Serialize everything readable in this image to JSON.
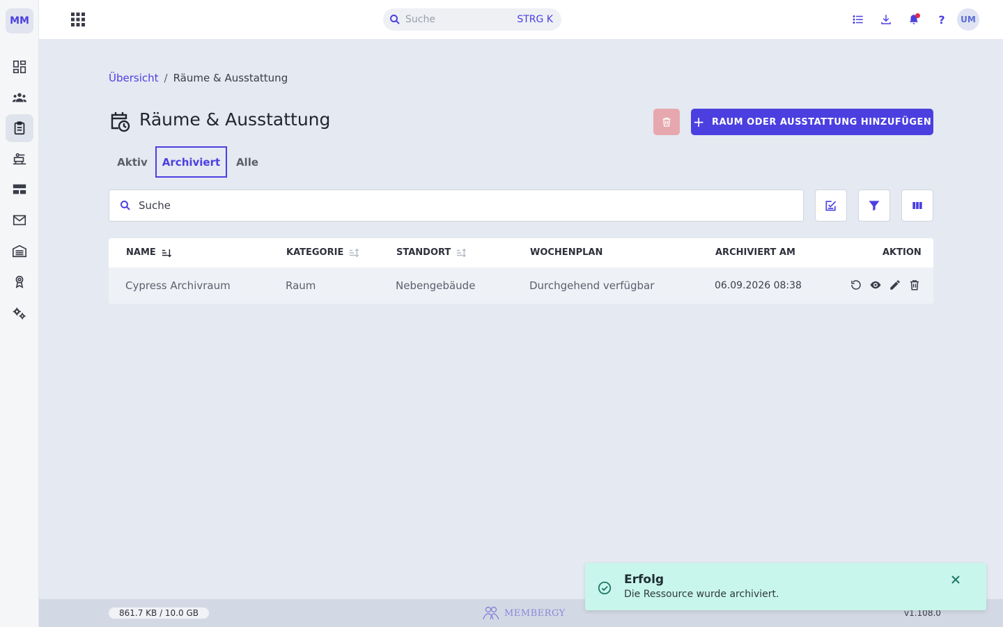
{
  "app": {
    "logo_text": "MM",
    "user_initials": "UM",
    "accent_color": "#4b3fe0"
  },
  "sidebar": {
    "items": [
      {
        "icon": "dashboard-icon"
      },
      {
        "icon": "members-icon"
      },
      {
        "icon": "clipboard-icon",
        "active": true
      },
      {
        "icon": "courses-icon"
      },
      {
        "icon": "layout-icon"
      },
      {
        "icon": "mail-icon"
      },
      {
        "icon": "warehouse-icon"
      },
      {
        "icon": "award-icon"
      },
      {
        "icon": "settings-icon"
      }
    ]
  },
  "topbar": {
    "search_placeholder": "Suche",
    "search_shortcut": "STRG K",
    "help_label": "?",
    "notification_dot_color": "#e5294a"
  },
  "breadcrumb": {
    "parent": "Übersicht",
    "separator": "/",
    "current": "Räume & Ausstattung"
  },
  "page": {
    "title": "Räume & Ausstattung",
    "add_button_label": "RAUM ODER AUSSTATTUNG HINZUFÜGEN",
    "add_button_icon": "+"
  },
  "tabs": [
    {
      "label": "Aktiv",
      "active": false
    },
    {
      "label": "Archiviert",
      "active": true
    },
    {
      "label": "Alle",
      "active": false
    }
  ],
  "table_search": {
    "placeholder": "Suche"
  },
  "table": {
    "columns": [
      "NAME",
      "KATEGORIE",
      "STANDORT",
      "WOCHENPLAN",
      "ARCHIVIERT AM",
      "AKTION"
    ],
    "rows": [
      {
        "name": "Cypress Archivraum",
        "kategorie": "Raum",
        "standort": "Nebengebäude",
        "wochenplan": "Durchgehend verfügbar",
        "archiviert_am": "06.09.2026 08:38"
      }
    ]
  },
  "footer": {
    "storage": "861.7 KB / 10.0 GB",
    "brand": "MEMBERGY",
    "version": "v1.108.0"
  },
  "toast": {
    "title": "Erfolg",
    "message": "Die Ressource wurde archiviert."
  }
}
